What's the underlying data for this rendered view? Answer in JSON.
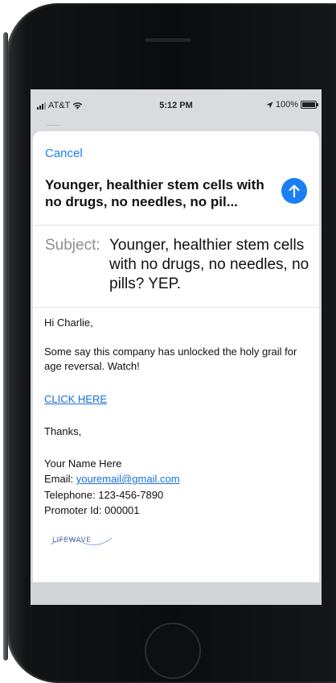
{
  "status_bar": {
    "carrier": "AT&T",
    "time": "5:12 PM",
    "battery": "100%",
    "battery_level": 1.0
  },
  "compose": {
    "cancel_label": "Cancel",
    "title": "Younger, healthier stem cells with no drugs, no needles, no pil...",
    "subject_label": "Subject:",
    "subject_value": "Younger, healthier stem cells with no drugs, no needles, no pills?   YEP.",
    "send_icon": "arrow-up-icon",
    "accent_color": "#1a7ef5"
  },
  "email_body": {
    "greeting": "Hi Charlie,",
    "paragraph": "Some say this company has unlocked the holy grail for age reversal.  Watch!",
    "cta_link": "CLICK HERE",
    "closing": "Thanks,",
    "signature_name": "Your Name Here",
    "email_label": "Email: ",
    "email_value": "youremail@gmail.com",
    "telephone": "Telephone: 123-456-7890",
    "promoter_id": "Promoter Id: 000001"
  },
  "logo": {
    "text": "LIFEWAVE"
  }
}
